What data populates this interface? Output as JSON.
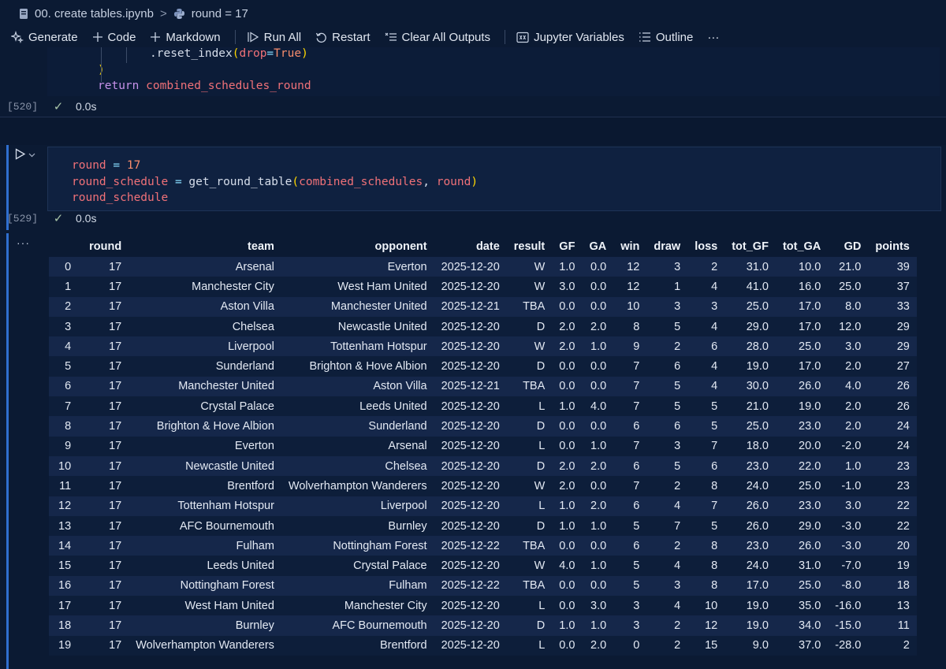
{
  "breadcrumb": {
    "file": "00. create tables.ipynb",
    "sep": ">",
    "symbol": "round = 17"
  },
  "toolbar": {
    "generate": "Generate",
    "code": "Code",
    "markdown": "Markdown",
    "run_all": "Run All",
    "restart": "Restart",
    "clear_outputs": "Clear All Outputs",
    "jupyter_variables": "Jupyter Variables",
    "outline": "Outline",
    "more": "···"
  },
  "prev_cell": {
    "line1_method": ".reset_index",
    "line1_paren_open": "(",
    "line1_arg": "drop",
    "line1_eq": "=",
    "line1_val": "True",
    "line1_paren_close": ")",
    "line2": ")",
    "line3_kw": "return",
    "line3_var": "combined_schedules_round",
    "exec_count": "[520]",
    "exec_time": "0.0s"
  },
  "active_cell": {
    "l1_var": "round",
    "l1_op": "=",
    "l1_num": "17",
    "l2_var": "round_schedule",
    "l2_op": "=",
    "l2_fn": "get_round_table",
    "l2_open": "(",
    "l2_arg1": "combined_schedules",
    "l2_comma": ",",
    "l2_arg2": "round",
    "l2_close": ")",
    "l3_var": "round_schedule",
    "exec_count": "[529]",
    "exec_time": "0.0s"
  },
  "output": {
    "ellipsis": "···",
    "columns": [
      "",
      "round",
      "team",
      "opponent",
      "date",
      "result",
      "GF",
      "GA",
      "win",
      "draw",
      "loss",
      "tot_GF",
      "tot_GA",
      "GD",
      "points"
    ],
    "rows": [
      [
        "0",
        "17",
        "Arsenal",
        "Everton",
        "2025-12-20",
        "W",
        "1.0",
        "0.0",
        "12",
        "3",
        "2",
        "31.0",
        "10.0",
        "21.0",
        "39"
      ],
      [
        "1",
        "17",
        "Manchester City",
        "West Ham United",
        "2025-12-20",
        "W",
        "3.0",
        "0.0",
        "12",
        "1",
        "4",
        "41.0",
        "16.0",
        "25.0",
        "37"
      ],
      [
        "2",
        "17",
        "Aston Villa",
        "Manchester United",
        "2025-12-21",
        "TBA",
        "0.0",
        "0.0",
        "10",
        "3",
        "3",
        "25.0",
        "17.0",
        "8.0",
        "33"
      ],
      [
        "3",
        "17",
        "Chelsea",
        "Newcastle United",
        "2025-12-20",
        "D",
        "2.0",
        "2.0",
        "8",
        "5",
        "4",
        "29.0",
        "17.0",
        "12.0",
        "29"
      ],
      [
        "4",
        "17",
        "Liverpool",
        "Tottenham Hotspur",
        "2025-12-20",
        "W",
        "2.0",
        "1.0",
        "9",
        "2",
        "6",
        "28.0",
        "25.0",
        "3.0",
        "29"
      ],
      [
        "5",
        "17",
        "Sunderland",
        "Brighton & Hove Albion",
        "2025-12-20",
        "D",
        "0.0",
        "0.0",
        "7",
        "6",
        "4",
        "19.0",
        "17.0",
        "2.0",
        "27"
      ],
      [
        "6",
        "17",
        "Manchester United",
        "Aston Villa",
        "2025-12-21",
        "TBA",
        "0.0",
        "0.0",
        "7",
        "5",
        "4",
        "30.0",
        "26.0",
        "4.0",
        "26"
      ],
      [
        "7",
        "17",
        "Crystal Palace",
        "Leeds United",
        "2025-12-20",
        "L",
        "1.0",
        "4.0",
        "7",
        "5",
        "5",
        "21.0",
        "19.0",
        "2.0",
        "26"
      ],
      [
        "8",
        "17",
        "Brighton & Hove Albion",
        "Sunderland",
        "2025-12-20",
        "D",
        "0.0",
        "0.0",
        "6",
        "6",
        "5",
        "25.0",
        "23.0",
        "2.0",
        "24"
      ],
      [
        "9",
        "17",
        "Everton",
        "Arsenal",
        "2025-12-20",
        "L",
        "0.0",
        "1.0",
        "7",
        "3",
        "7",
        "18.0",
        "20.0",
        "-2.0",
        "24"
      ],
      [
        "10",
        "17",
        "Newcastle United",
        "Chelsea",
        "2025-12-20",
        "D",
        "2.0",
        "2.0",
        "6",
        "5",
        "6",
        "23.0",
        "22.0",
        "1.0",
        "23"
      ],
      [
        "11",
        "17",
        "Brentford",
        "Wolverhampton Wanderers",
        "2025-12-20",
        "W",
        "2.0",
        "0.0",
        "7",
        "2",
        "8",
        "24.0",
        "25.0",
        "-1.0",
        "23"
      ],
      [
        "12",
        "17",
        "Tottenham Hotspur",
        "Liverpool",
        "2025-12-20",
        "L",
        "1.0",
        "2.0",
        "6",
        "4",
        "7",
        "26.0",
        "23.0",
        "3.0",
        "22"
      ],
      [
        "13",
        "17",
        "AFC Bournemouth",
        "Burnley",
        "2025-12-20",
        "D",
        "1.0",
        "1.0",
        "5",
        "7",
        "5",
        "26.0",
        "29.0",
        "-3.0",
        "22"
      ],
      [
        "14",
        "17",
        "Fulham",
        "Nottingham Forest",
        "2025-12-22",
        "TBA",
        "0.0",
        "0.0",
        "6",
        "2",
        "8",
        "23.0",
        "26.0",
        "-3.0",
        "20"
      ],
      [
        "15",
        "17",
        "Leeds United",
        "Crystal Palace",
        "2025-12-20",
        "W",
        "4.0",
        "1.0",
        "5",
        "4",
        "8",
        "24.0",
        "31.0",
        "-7.0",
        "19"
      ],
      [
        "16",
        "17",
        "Nottingham Forest",
        "Fulham",
        "2025-12-22",
        "TBA",
        "0.0",
        "0.0",
        "5",
        "3",
        "8",
        "17.0",
        "25.0",
        "-8.0",
        "18"
      ],
      [
        "17",
        "17",
        "West Ham United",
        "Manchester City",
        "2025-12-20",
        "L",
        "0.0",
        "3.0",
        "3",
        "4",
        "10",
        "19.0",
        "35.0",
        "-16.0",
        "13"
      ],
      [
        "18",
        "17",
        "Burnley",
        "AFC Bournemouth",
        "2025-12-20",
        "D",
        "1.0",
        "1.0",
        "3",
        "2",
        "12",
        "19.0",
        "34.0",
        "-15.0",
        "11"
      ],
      [
        "19",
        "17",
        "Wolverhampton Wanderers",
        "Brentford",
        "2025-12-20",
        "L",
        "0.0",
        "2.0",
        "0",
        "2",
        "15",
        "9.0",
        "37.0",
        "-28.0",
        "2"
      ]
    ]
  }
}
